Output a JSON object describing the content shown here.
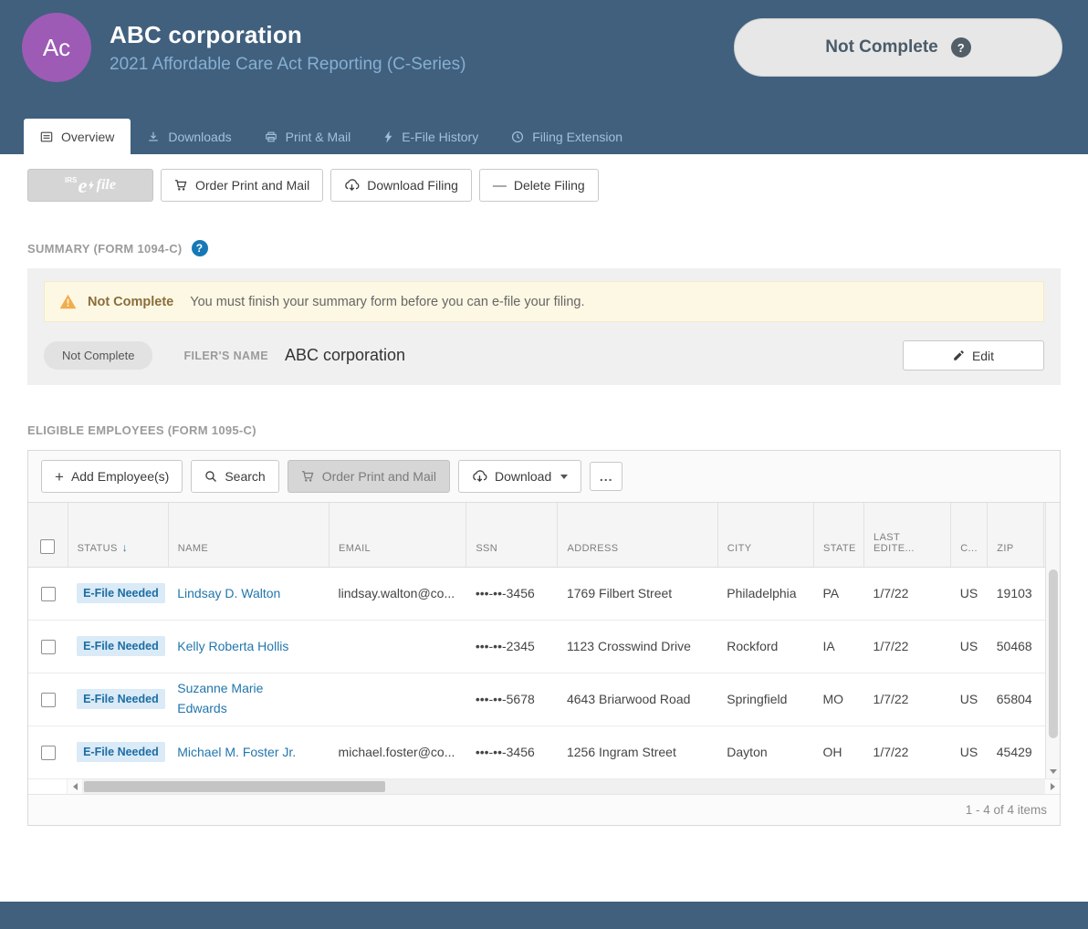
{
  "header": {
    "avatar": "Ac",
    "title": "ABC corporation",
    "subtitle": "2021 Affordable Care Act Reporting (C-Series)",
    "status_button": {
      "label": "Not Complete",
      "help": "?"
    }
  },
  "tabs": [
    {
      "label": "Overview"
    },
    {
      "label": "Downloads"
    },
    {
      "label": "Print & Mail"
    },
    {
      "label": "E-File History"
    },
    {
      "label": "Filing Extension"
    }
  ],
  "actions": {
    "efile_logo": {
      "irs": "IRS",
      "e": "e",
      "file": "file"
    },
    "order_print_mail": "Order Print and Mail",
    "download_filing": "Download Filing",
    "delete_filing": "Delete Filing",
    "delete_icon": "—"
  },
  "summary": {
    "heading": "SUMMARY (FORM 1094-C)",
    "help": "?",
    "warning": {
      "badge": "Not Complete",
      "message": "You must finish your summary form before you can e-file your filing."
    },
    "status_pill": "Not Complete",
    "filer_label": "FILER'S NAME",
    "filer_value": "ABC corporation",
    "edit_label": "Edit"
  },
  "employees": {
    "heading": "ELIGIBLE EMPLOYEES (FORM 1095-C)",
    "toolbar": {
      "add": "Add Employee(s)",
      "add_icon": "+",
      "search": "Search",
      "order_print_mail": "Order Print and Mail",
      "download": "Download",
      "more": "..."
    },
    "columns": {
      "status": "STATUS",
      "name": "NAME",
      "email": "EMAIL",
      "ssn": "SSN",
      "address": "ADDRESS",
      "city": "CITY",
      "state": "STATE",
      "last_edited": "LAST EDITE...",
      "country": "C...",
      "zip": "ZIP"
    },
    "sort_indicator": "↓",
    "rows": [
      {
        "status": "E-File Needed",
        "name": "Lindsay D. Walton",
        "email": "lindsay.walton@co...",
        "ssn": "•••-••-3456",
        "address": "1769 Filbert Street",
        "city": "Philadelphia",
        "state": "PA",
        "last_edited": "1/7/22",
        "country": "US",
        "zip": "19103"
      },
      {
        "status": "E-File Needed",
        "name": "Kelly Roberta Hollis",
        "email": "",
        "ssn": "•••-••-2345",
        "address": "1123 Crosswind Drive",
        "city": "Rockford",
        "state": "IA",
        "last_edited": "1/7/22",
        "country": "US",
        "zip": "50468"
      },
      {
        "status": "E-File Needed",
        "name": "Suzanne Marie Edwards",
        "email": "",
        "ssn": "•••-••-5678",
        "address": "4643 Briarwood Road",
        "city": "Springfield",
        "state": "MO",
        "last_edited": "1/7/22",
        "country": "US",
        "zip": "65804"
      },
      {
        "status": "E-File Needed",
        "name": "Michael M. Foster Jr.",
        "email": "michael.foster@co...",
        "ssn": "•••-••-3456",
        "address": "1256 Ingram Street",
        "city": "Dayton",
        "state": "OH",
        "last_edited": "1/7/22",
        "country": "US",
        "zip": "45429"
      }
    ],
    "pager": "1 - 4 of 4 items"
  }
}
